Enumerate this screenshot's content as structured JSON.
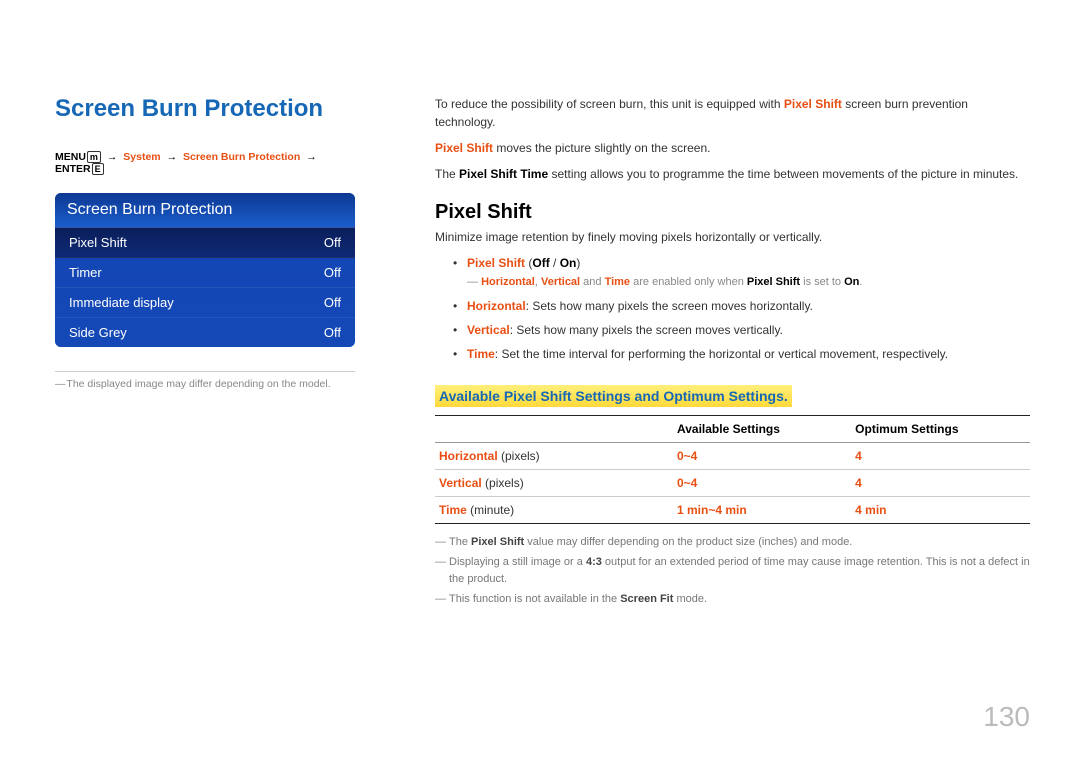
{
  "left": {
    "title": "Screen Burn Protection",
    "breadcrumb": {
      "menu": "MENU",
      "system": "System",
      "sbp": "Screen Burn Protection",
      "enter": "ENTER"
    },
    "osd": {
      "header": "Screen Burn Protection",
      "rows": [
        {
          "label": "Pixel Shift",
          "value": "Off",
          "selected": true
        },
        {
          "label": "Timer",
          "value": "Off",
          "selected": false
        },
        {
          "label": "Immediate display",
          "value": "Off",
          "selected": false
        },
        {
          "label": "Side Grey",
          "value": "Off",
          "selected": false
        }
      ]
    },
    "note": "The displayed image may differ depending on the model."
  },
  "right": {
    "intro": {
      "line1a": "To reduce the possibility of screen burn, this unit is equipped with ",
      "line1b": "Pixel Shift",
      "line1c": " screen burn prevention technology.",
      "line2a": "Pixel Shift",
      "line2b": " moves the picture slightly on the screen.",
      "line3a": "The ",
      "line3b": "Pixel Shift Time",
      "line3c": " setting allows you to programme the time between movements of the picture in minutes."
    },
    "section_title": "Pixel Shift",
    "section_desc": "Minimize image retention by finely moving pixels horizontally or vertically.",
    "bullets": {
      "b1": {
        "label": "Pixel Shift",
        "paren": "(",
        "opt1": "Off",
        "slash": " / ",
        "opt2": "On",
        "close": ")"
      },
      "sub_a": "Horizontal",
      "sub_b": "Vertical",
      "sub_c": "Time",
      "sub_mid1": ", ",
      "sub_mid2": " and ",
      "sub_tail1": " are enabled only when ",
      "sub_ps": "Pixel Shift",
      "sub_tail2": " is set to ",
      "sub_on": "On",
      "sub_end": ".",
      "b2_label": "Horizontal",
      "b2_text": ": Sets how many pixels the screen moves horizontally.",
      "b3_label": "Vertical",
      "b3_text": ": Sets how many pixels the screen moves vertically.",
      "b4_label": "Time",
      "b4_text": ": Set the time interval for performing the horizontal or vertical movement, respectively."
    },
    "table_title": "Available Pixel Shift Settings and Optimum Settings.",
    "table": {
      "h_blank": "",
      "h_avail": "Available Settings",
      "h_opt": "Optimum Settings",
      "rows": [
        {
          "name": "Horizontal",
          "unit": " (pixels)",
          "avail": "0~4",
          "opt": "4"
        },
        {
          "name": "Vertical",
          "unit": " (pixels)",
          "avail": "0~4",
          "opt": "4"
        },
        {
          "name": "Time",
          "unit": " (minute)",
          "avail": "1 min~4 min",
          "opt": "4 min"
        }
      ]
    },
    "footnotes": {
      "f1a": "The ",
      "f1b": "Pixel Shift",
      "f1c": " value may differ depending on the product size (inches) and mode.",
      "f2a": "Displaying a still image or a ",
      "f2b": "4:3",
      "f2c": " output for an extended period of time may cause image retention. This is not a defect in the product.",
      "f3a": "This function is not available in the ",
      "f3b": "Screen Fit",
      "f3c": " mode."
    }
  },
  "page_number": "130"
}
